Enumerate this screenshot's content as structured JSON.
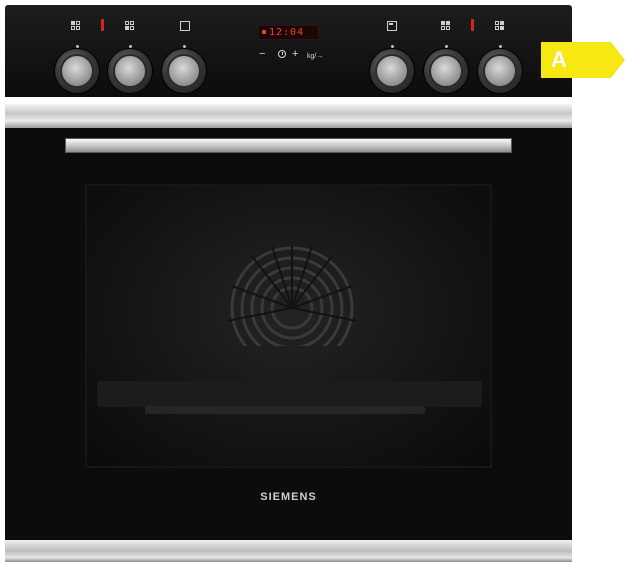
{
  "product": {
    "brand": "SIEMENS",
    "display_readout": "12:04",
    "controls": {
      "minus": "−",
      "plus": "+",
      "unit": "kg/→"
    },
    "energy_class": "A",
    "colors": {
      "energy": "#f7e712",
      "led": "#ff3b2a",
      "body": "#0c0c0c"
    }
  }
}
